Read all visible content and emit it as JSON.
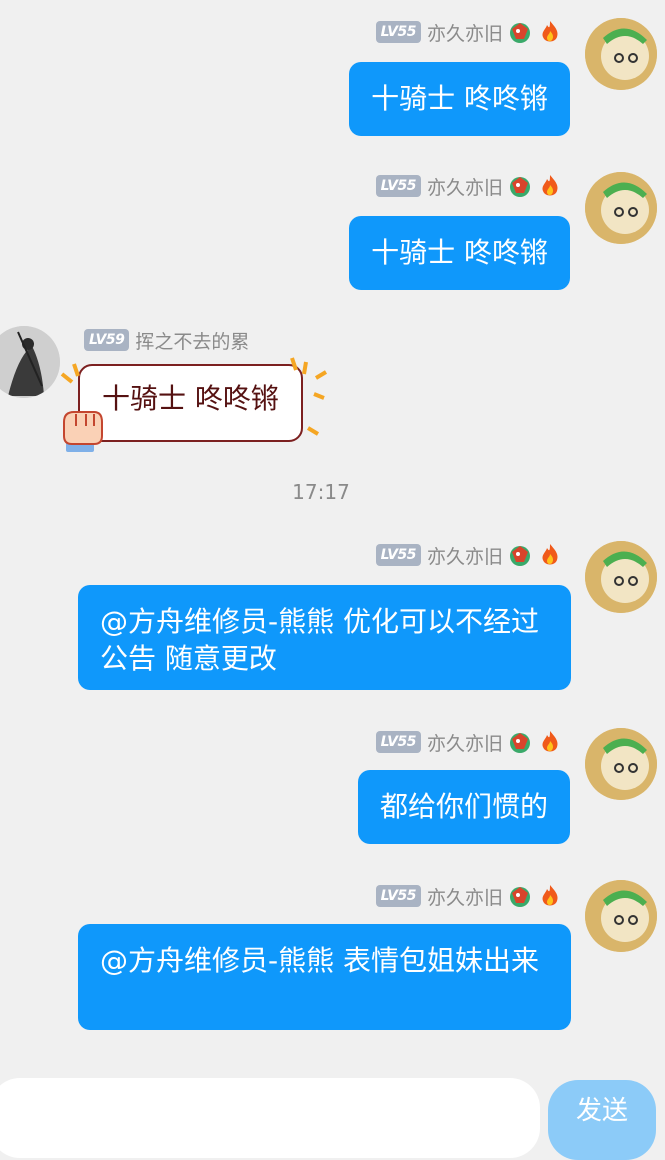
{
  "messages": [
    {
      "side": "right",
      "level": "LV55",
      "username": "亦久亦旧",
      "text": "十骑士 咚咚锵"
    },
    {
      "side": "right",
      "level": "LV55",
      "username": "亦久亦旧",
      "text": "十骑士 咚咚锵"
    },
    {
      "side": "left",
      "level": "LV59",
      "username": "挥之不去的累",
      "text": "十骑士 咚咚锵"
    },
    {
      "side": "right",
      "level": "LV55",
      "username": "亦久亦旧",
      "text": "@方舟维修员-熊熊 优化可以不经过公告 随意更改"
    },
    {
      "side": "right",
      "level": "LV55",
      "username": "亦久亦旧",
      "text": "都给你们惯的"
    },
    {
      "side": "right",
      "level": "LV55",
      "username": "亦久亦旧",
      "text": "@方舟维修员-熊熊 表情包姐妹出来"
    }
  ],
  "timestamp": "17:17",
  "input": {
    "send_label": "发送"
  },
  "colors": {
    "bubble": "#0f98fb",
    "background": "#f0f0f0",
    "send_disabled": "#8ccbf8"
  },
  "icons": [
    "dragon-badge-icon",
    "fire-badge-icon",
    "fist-emoji-icon"
  ]
}
